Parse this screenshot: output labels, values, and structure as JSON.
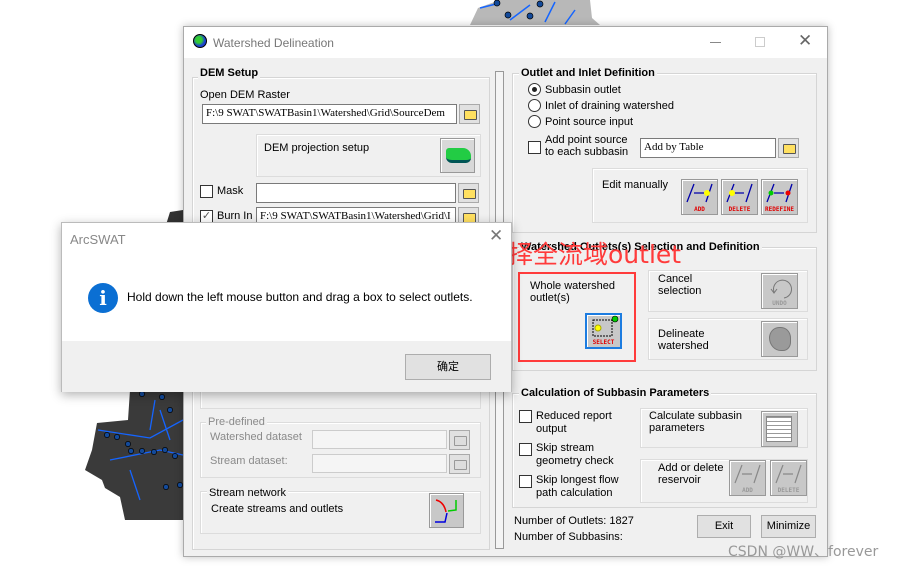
{
  "window": {
    "title": "Watershed Delineation",
    "minimize_icon": "minimize-icon",
    "maximize_icon": "maximize-icon",
    "close_icon": "close-icon",
    "app_icon": "globe-icon"
  },
  "dem_setup": {
    "title": "DEM Setup",
    "open_dem_label": "Open DEM Raster",
    "dem_path": "F:\\9 SWAT\\SWATBasin1\\Watershed\\Grid\\SourceDem",
    "projection_label": "DEM projection setup",
    "mask_label": "Mask",
    "mask_checked": false,
    "mask_value": "",
    "burn_in_label": "Burn In",
    "burn_in_checked": true,
    "burn_in_value": "F:\\9 SWAT\\SWATBasin1\\Watershed\\Grid\\I"
  },
  "predefined": {
    "title": "Pre-defined",
    "watershed_label": "Watershed dataset",
    "stream_label": "Stream dataset:"
  },
  "stream_network": {
    "title": "Stream network",
    "create_label": "Create streams and outlets"
  },
  "outlet_inlet": {
    "title": "Outlet and Inlet Definition",
    "options": [
      {
        "label": "Subbasin outlet",
        "selected": true
      },
      {
        "label": "Inlet of draining watershed",
        "selected": false
      },
      {
        "label": "Point source input",
        "selected": false
      }
    ],
    "add_point_line1": "Add point source",
    "add_point_line2": "to each subbasin",
    "add_by_table": "Add by Table",
    "edit_manually": "Edit manually",
    "add_btn": "ADD",
    "delete_btn": "DELETE",
    "redefine_btn": "REDEFINE"
  },
  "watershed_outlets": {
    "title": "Watershed Outlets(s) Selection and Definition",
    "whole_line1": "Whole watershed",
    "whole_line2": "outlet(s)",
    "select_btn": "SELECT",
    "cancel_line1": "Cancel",
    "cancel_line2": "selection",
    "undo_btn": "UNDO",
    "delineate_line1": "Delineate",
    "delineate_line2": "watershed"
  },
  "calc": {
    "title": "Calculation of Subbasin Parameters",
    "reduced_line1": "Reduced  report",
    "reduced_line2": "output",
    "skip_stream_line1": "Skip stream",
    "skip_stream_line2": "geometry check",
    "skip_longest_line1": "Skip longest flow",
    "skip_longest_line2": "path calculation",
    "calc_line1": "Calculate subbasin",
    "calc_line2": "parameters",
    "reservoir_line1": "Add or delete",
    "reservoir_line2": "reservoir",
    "add_btn": "ADD",
    "delete_btn": "DELETE"
  },
  "footer": {
    "outlets_label": "Number of Outlets: 1827",
    "subbasins_label": "Number of Subbasins:",
    "exit": "Exit",
    "minimize": "Minimize"
  },
  "dialog": {
    "title": "ArcSWAT",
    "message": "Hold down the left mouse button and drag a box to select outlets.",
    "ok": "确定",
    "icon": "info-icon"
  },
  "annotation": {
    "text": "单击，选择全流域outlet",
    "color": "#ff3b3b"
  },
  "watermark": "CSDN @WW、forever"
}
